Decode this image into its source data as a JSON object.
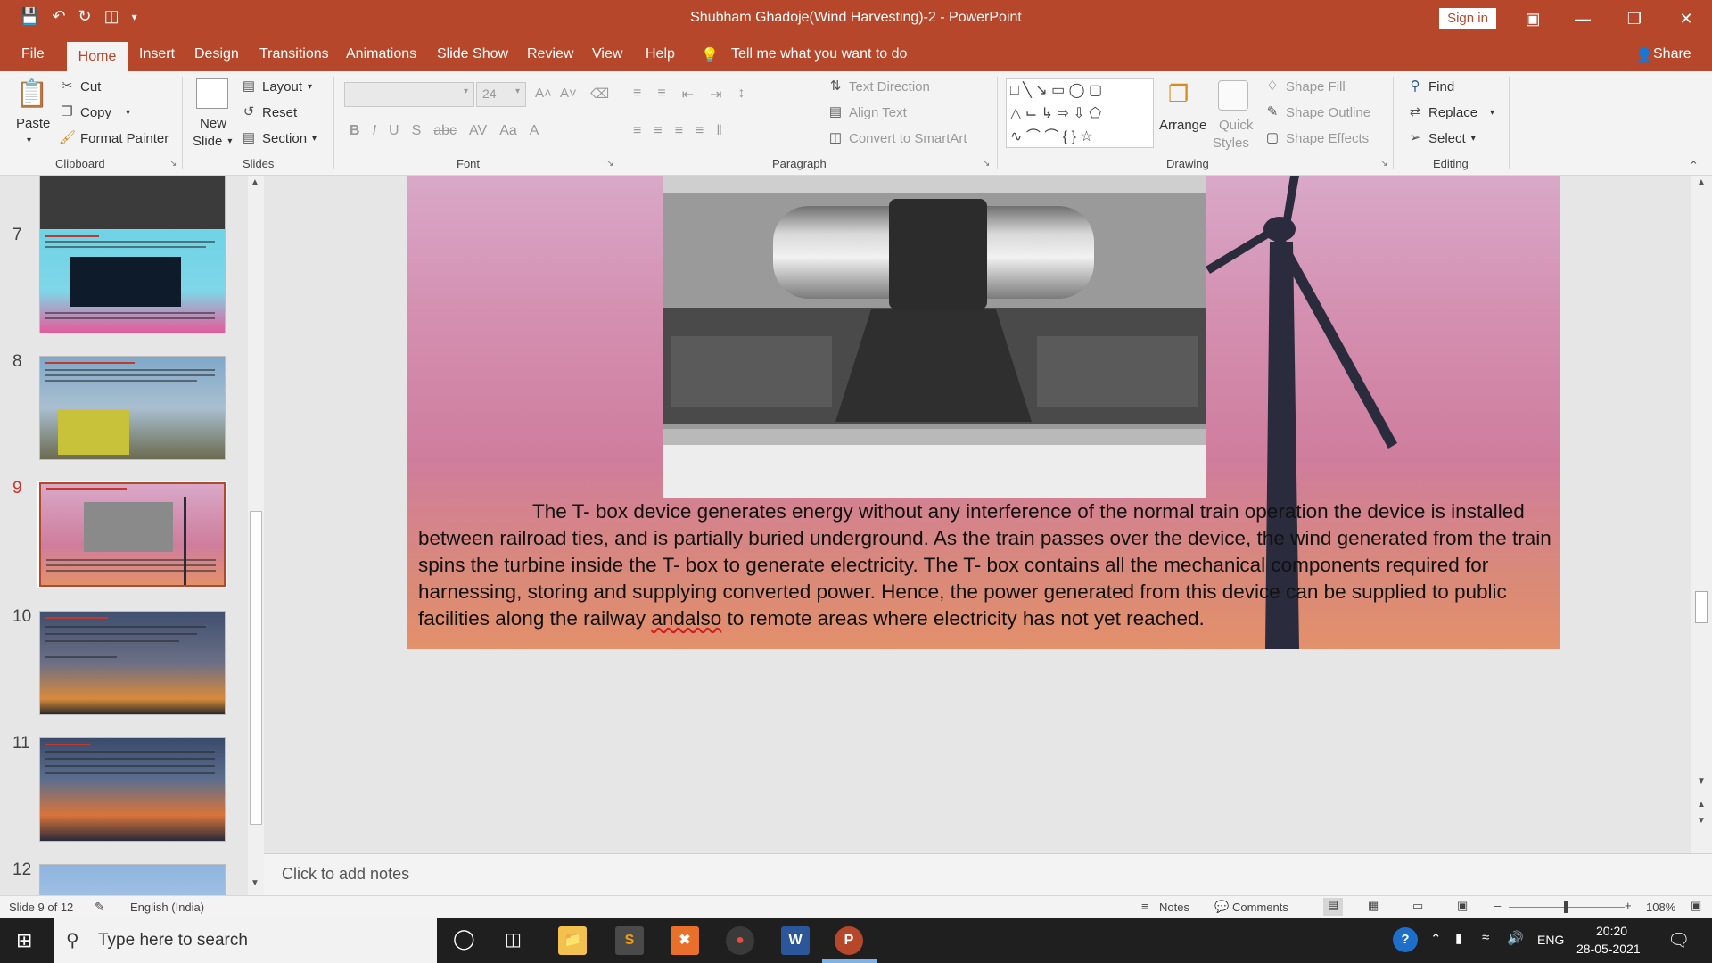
{
  "window": {
    "title": "Shubham Ghadoje(Wind Harvesting)-2  -  PowerPoint",
    "sign_in": "Sign in",
    "accent": "#b7472a"
  },
  "tabs": [
    "File",
    "Home",
    "Insert",
    "Design",
    "Transitions",
    "Animations",
    "Slide Show",
    "Review",
    "View",
    "Help"
  ],
  "tell_me": "Tell me what you want to do",
  "share": "Share",
  "ribbon": {
    "clipboard": {
      "paste": "Paste",
      "cut": "Cut",
      "copy": "Copy",
      "format_painter": "Format Painter",
      "label": "Clipboard"
    },
    "slides": {
      "new_slide_1": "New",
      "new_slide_2": "Slide",
      "layout": "Layout",
      "reset": "Reset",
      "section": "Section",
      "label": "Slides"
    },
    "font": {
      "size": "24",
      "label": "Font",
      "change_case": "Aa"
    },
    "paragraph": {
      "text_direction": "Text Direction",
      "align_text": "Align Text",
      "convert": "Convert to SmartArt",
      "label": "Paragraph"
    },
    "drawing": {
      "arrange": "Arrange",
      "quick_styles_1": "Quick",
      "quick_styles_2": "Styles",
      "shape_fill": "Shape Fill",
      "shape_outline": "Shape Outline",
      "shape_effects": "Shape Effects",
      "label": "Drawing"
    },
    "editing": {
      "find": "Find",
      "replace": "Replace",
      "select": "Select",
      "label": "Editing"
    }
  },
  "thumbnails": [
    {
      "num": "7"
    },
    {
      "num": "8"
    },
    {
      "num": "9",
      "selected": true
    },
    {
      "num": "10"
    },
    {
      "num": "11"
    },
    {
      "num": "12"
    }
  ],
  "slide": {
    "body_text_before": "The T- box device generates energy without any interference of the normal train operation the device is installed between railroad ties, and is partially buried underground. As the train passes over the device, the wind generated from the train spins the turbine inside the T- box to generate electricity. The T- box contains all the mechanical components required for harnessing, storing and supplying converted power. Hence, the power generated from this device can be supplied to public facilities along the railway ",
    "body_text_misspelled": "andalso",
    "body_text_after": " to remote areas where electricity has not yet reached."
  },
  "notes_placeholder": "Click to add notes",
  "status": {
    "slide_count": "Slide 9 of 12",
    "language": "English (India)",
    "notes": "Notes",
    "comments": "Comments",
    "zoom": "108%"
  },
  "taskbar": {
    "search_placeholder": "Type here to search",
    "lang": "ENG",
    "time": "20:20",
    "date": "28-05-2021"
  }
}
